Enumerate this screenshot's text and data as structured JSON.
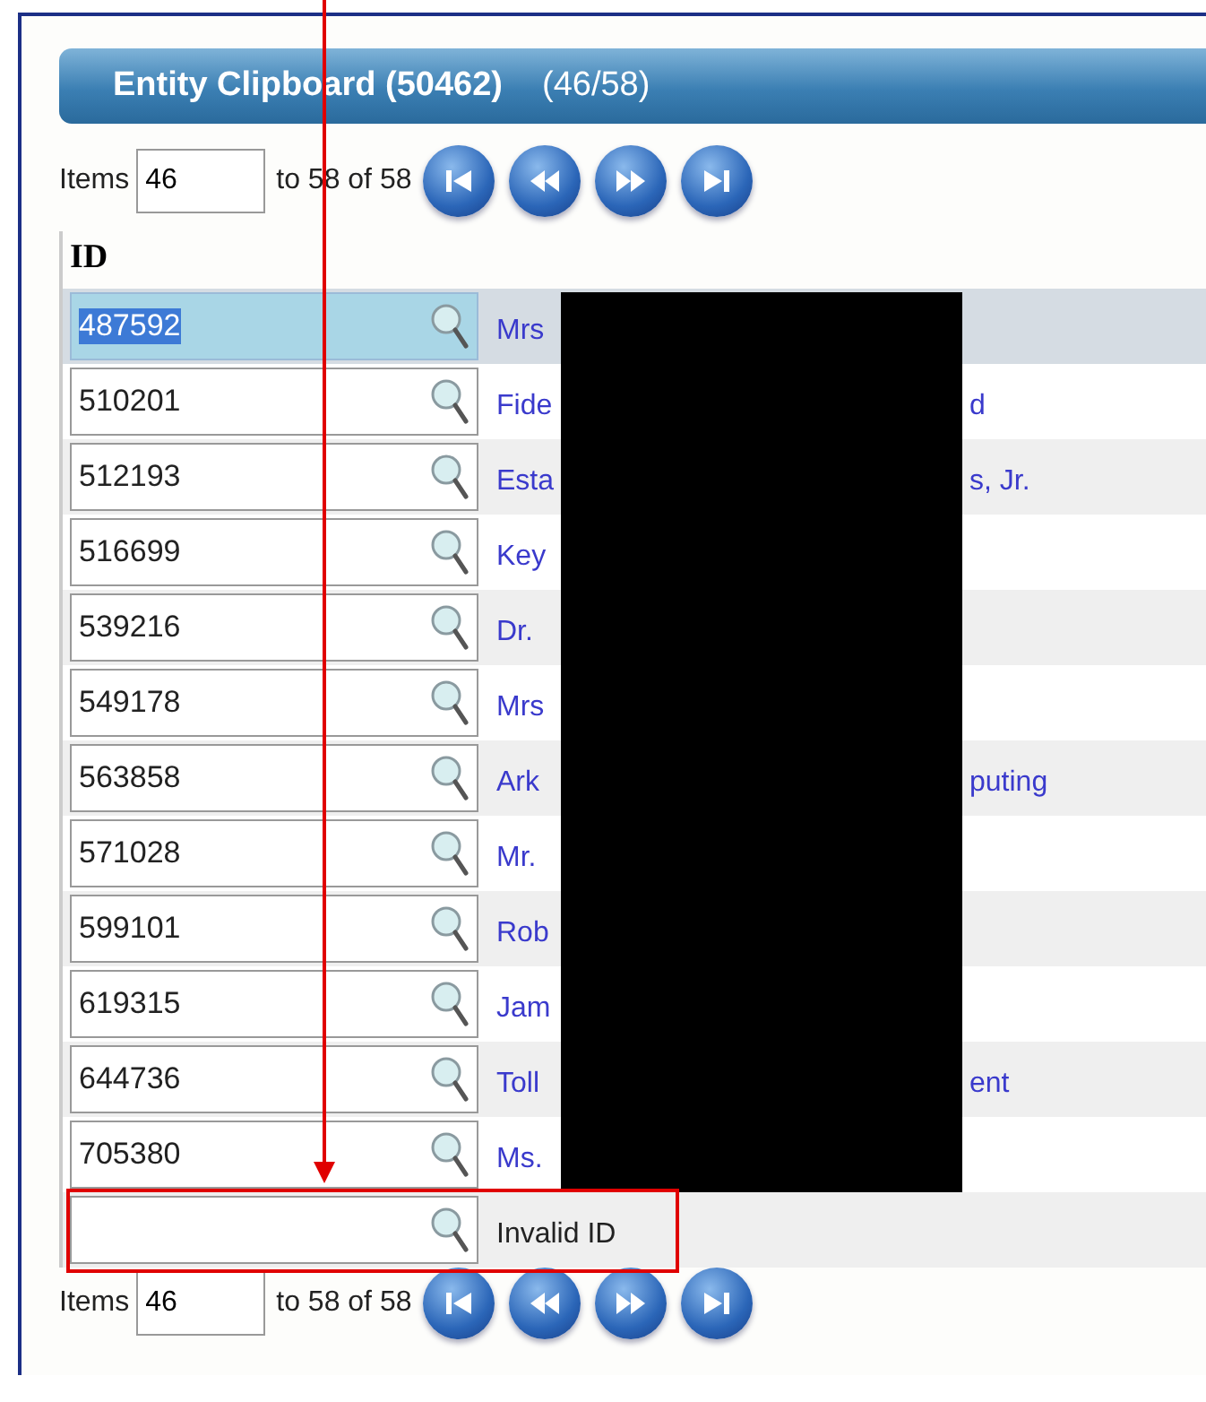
{
  "header": {
    "title": "Entity Clipboard (50462)",
    "count": "(46/58)"
  },
  "pager_top": {
    "label": "Items",
    "value": "46",
    "range": "to 58 of 58"
  },
  "column_header": "ID",
  "rows": [
    {
      "id": "487592",
      "selected": true,
      "name_start": "Mrs"
    },
    {
      "id": "510201",
      "selected": false,
      "name_start": "Fide",
      "name_end": "d"
    },
    {
      "id": "512193",
      "selected": false,
      "name_start": "Esta",
      "name_end": "s, Jr."
    },
    {
      "id": "516699",
      "selected": false,
      "name_start": "Key"
    },
    {
      "id": "539216",
      "selected": false,
      "name_start": "Dr."
    },
    {
      "id": "549178",
      "selected": false,
      "name_start": "Mrs"
    },
    {
      "id": "563858",
      "selected": false,
      "name_start": "Ark",
      "name_end": "puting"
    },
    {
      "id": "571028",
      "selected": false,
      "name_start": "Mr."
    },
    {
      "id": "599101",
      "selected": false,
      "name_start": "Rob"
    },
    {
      "id": "619315",
      "selected": false,
      "name_start": "Jam"
    },
    {
      "id": "644736",
      "selected": false,
      "name_start": "Toll",
      "name_end": "ent"
    },
    {
      "id": "705380",
      "selected": false,
      "name_start": "Ms."
    }
  ],
  "new_row": {
    "message": "Invalid ID"
  },
  "pager_bottom": {
    "label": "Items",
    "value": "46",
    "range": "to 58 of 58"
  }
}
